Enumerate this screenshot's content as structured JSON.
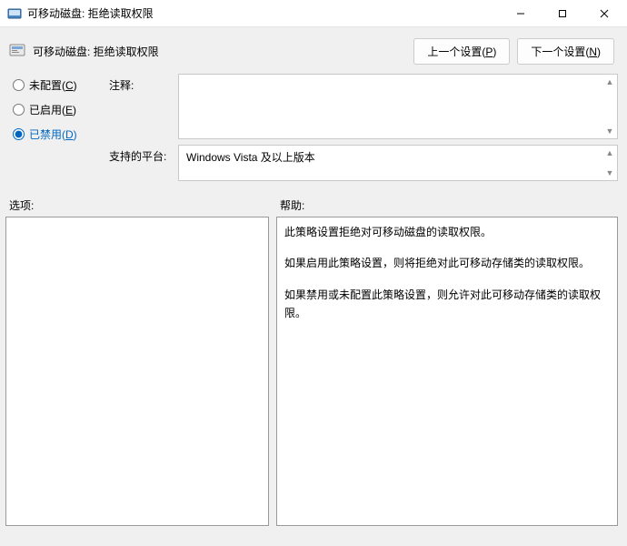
{
  "window": {
    "title": "可移动磁盘: 拒绝读取权限"
  },
  "header": {
    "policy_title": "可移动磁盘: 拒绝读取权限",
    "prev_btn_prefix": "上一个设置(",
    "prev_btn_mnemonic": "P",
    "prev_btn_suffix": ")",
    "next_btn_prefix": "下一个设置(",
    "next_btn_mnemonic": "N",
    "next_btn_suffix": ")"
  },
  "radios": {
    "not_configured_prefix": "未配置(",
    "not_configured_m": "C",
    "not_configured_suffix": ")",
    "enabled_prefix": "已启用(",
    "enabled_m": "E",
    "enabled_suffix": ")",
    "disabled_prefix": "已禁用(",
    "disabled_m": "D",
    "disabled_suffix": ")",
    "selected": "disabled"
  },
  "labels": {
    "comment": "注释:",
    "platform": "支持的平台:",
    "options": "选项:",
    "help": "帮助:"
  },
  "fields": {
    "comment": "",
    "platform": "Windows Vista 及以上版本"
  },
  "help": {
    "p1": "此策略设置拒绝对可移动磁盘的读取权限。",
    "p2": "如果启用此策略设置，则将拒绝对此可移动存储类的读取权限。",
    "p3": "如果禁用或未配置此策略设置，则允许对此可移动存储类的读取权限。"
  }
}
